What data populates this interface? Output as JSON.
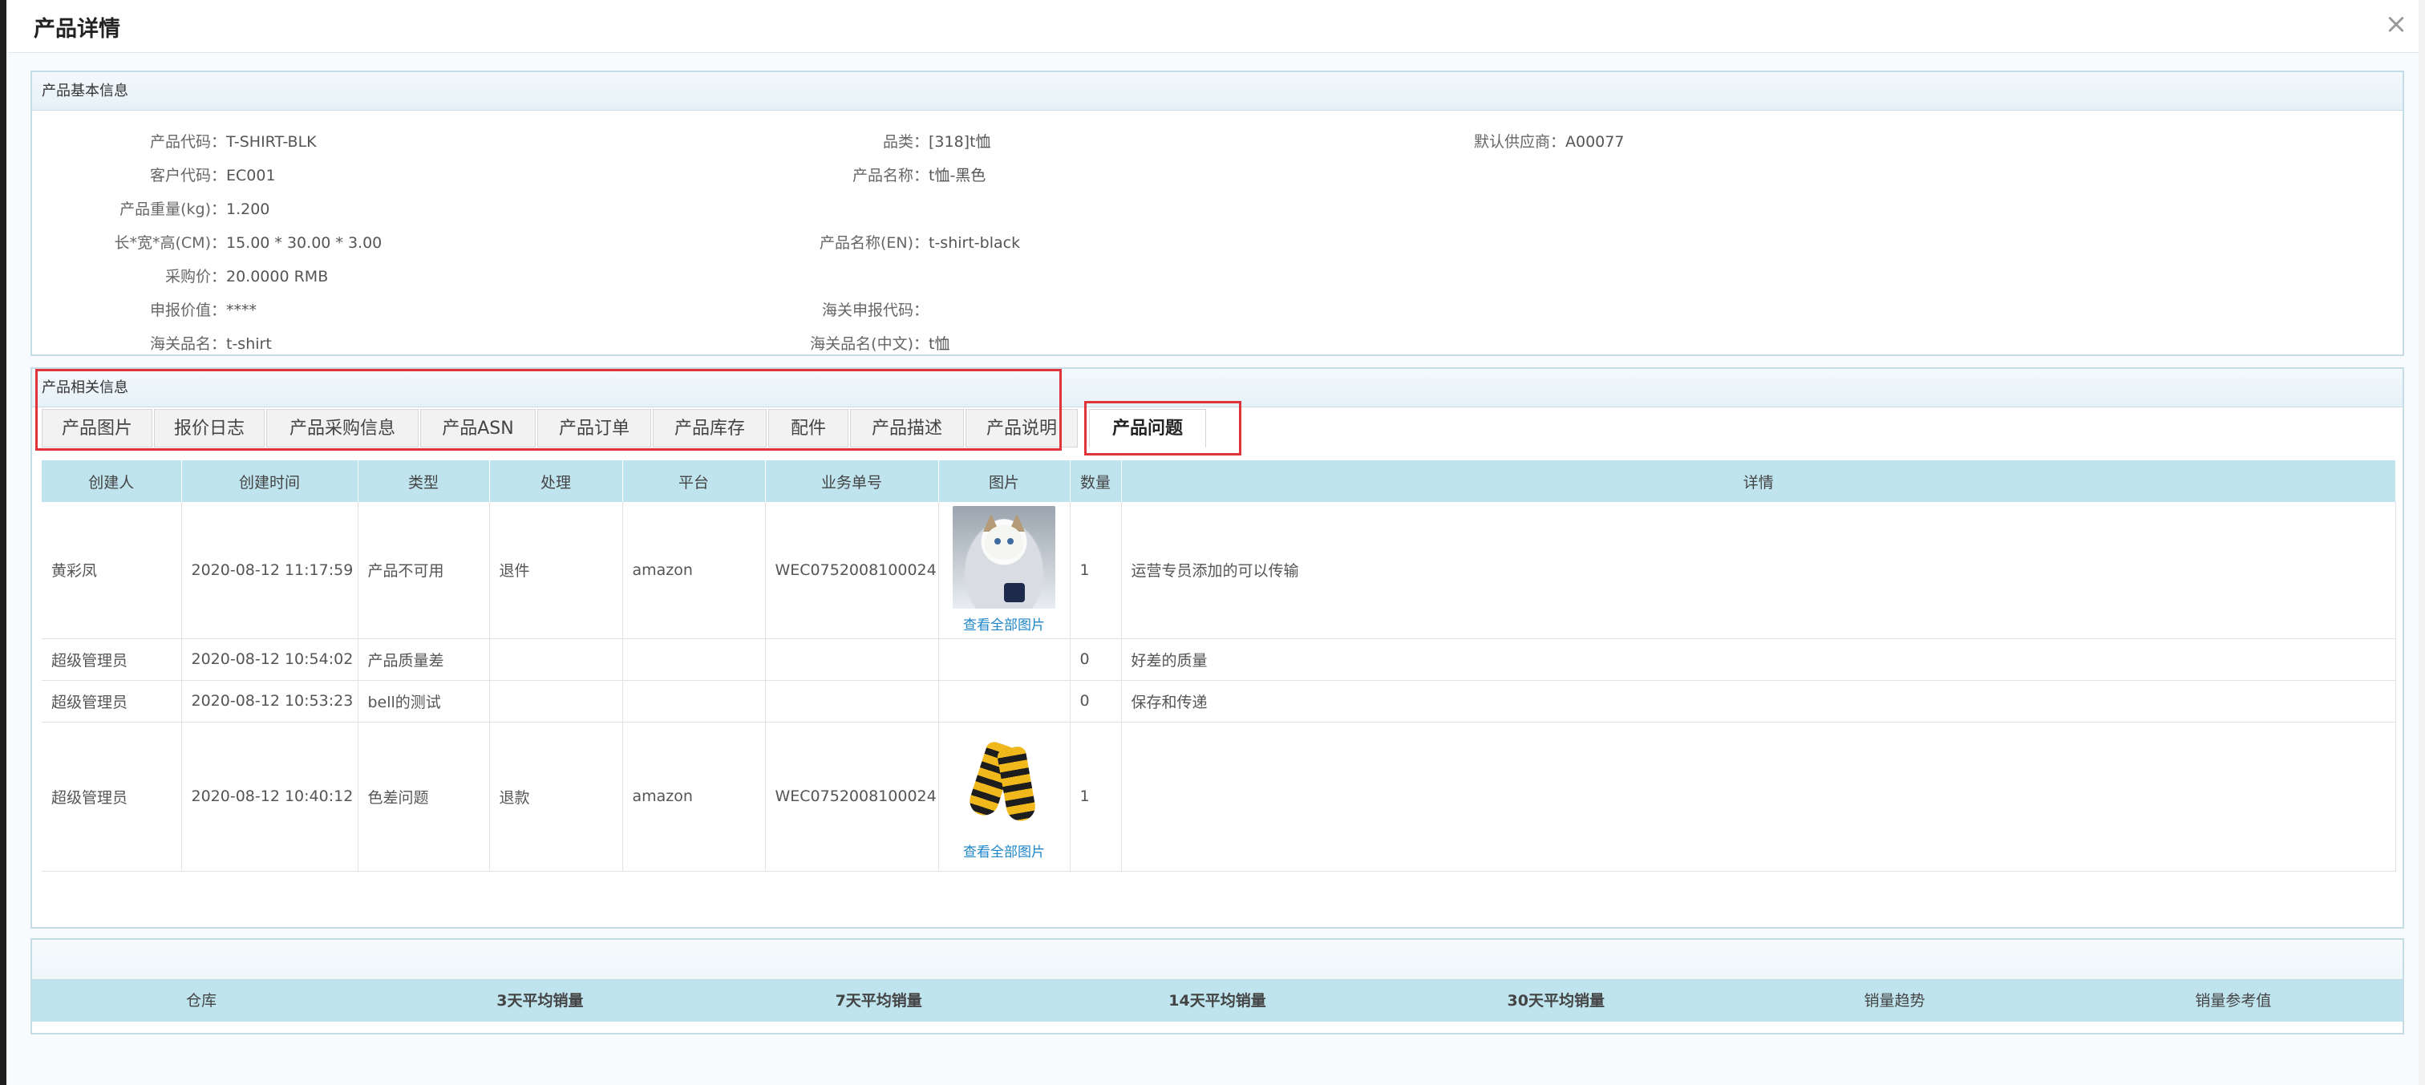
{
  "dialog": {
    "title": "产品详情",
    "close_icon": "close-icon"
  },
  "basic": {
    "heading": "产品基本信息",
    "fields": {
      "product_code": {
        "label": "产品代码：",
        "value": "T-SHIRT-BLK"
      },
      "customer_code": {
        "label": "客户代码：",
        "value": "EC001"
      },
      "weight": {
        "label": "产品重量(kg)：",
        "value": "1.200"
      },
      "dimensions": {
        "label": "长*宽*高(CM)：",
        "value": "15.00 * 30.00 * 3.00"
      },
      "purchase_price": {
        "label": "采购价：",
        "value": "20.0000 RMB"
      },
      "declared_value": {
        "label": "申报价值：",
        "value": "****"
      },
      "customs_name": {
        "label": "海关品名：",
        "value": "t-shirt"
      },
      "category": {
        "label": "品类：",
        "value": "[318]t恤"
      },
      "product_name": {
        "label": "产品名称：",
        "value": "t恤-黑色"
      },
      "product_name_en": {
        "label": "产品名称(EN)：",
        "value": "t-shirt-black"
      },
      "customs_code": {
        "label": "海关申报代码：",
        "value": ""
      },
      "customs_name_cn": {
        "label": "海关品名(中文)：",
        "value": "t恤"
      },
      "default_supplier": {
        "label": "默认供应商：",
        "value": "A00077"
      }
    }
  },
  "related": {
    "heading": "产品相关信息",
    "tabs": [
      "产品图片",
      "报价日志",
      "产品采购信息",
      "产品ASN",
      "产品订单",
      "产品库存",
      "配件",
      "产品描述",
      "产品说明",
      "产品问题"
    ],
    "active_tab": "产品问题",
    "columns": [
      "创建人",
      "创建时间",
      "类型",
      "处理",
      "平台",
      "业务单号",
      "图片",
      "数量",
      "详情"
    ],
    "rows": [
      {
        "creator": "黄彩凤",
        "time": "2020-08-12 11:17:59",
        "type": "产品不可用",
        "handle": "退件",
        "platform": "amazon",
        "order": "WEC0752008100024",
        "image": "cat-photo",
        "image_link": "查看全部图片",
        "qty": "1",
        "detail": "运营专员添加的可以传输"
      },
      {
        "creator": "超级管理员",
        "time": "2020-08-12 10:54:02",
        "type": "产品质量差",
        "handle": "",
        "platform": "",
        "order": "",
        "image": "",
        "image_link": "",
        "qty": "0",
        "detail": "好差的质量"
      },
      {
        "creator": "超级管理员",
        "time": "2020-08-12 10:53:23",
        "type": "bell的测试",
        "handle": "",
        "platform": "",
        "order": "",
        "image": "",
        "image_link": "",
        "qty": "0",
        "detail": "保存和传递"
      },
      {
        "creator": "超级管理员",
        "time": "2020-08-12 10:40:12",
        "type": "色差问题",
        "handle": "退款",
        "platform": "amazon",
        "order": "WEC0752008100024",
        "image": "socks-photo",
        "image_link": "查看全部图片",
        "qty": "1",
        "detail": ""
      }
    ]
  },
  "sales": {
    "columns": [
      "仓库",
      "3天平均销量",
      "7天平均销量",
      "14天平均销量",
      "30天平均销量",
      "销量趋势",
      "销量参考值"
    ]
  },
  "colors": {
    "highlight": "#e0333a",
    "table_header": "#bfe4ee",
    "link": "#1e86c8"
  }
}
